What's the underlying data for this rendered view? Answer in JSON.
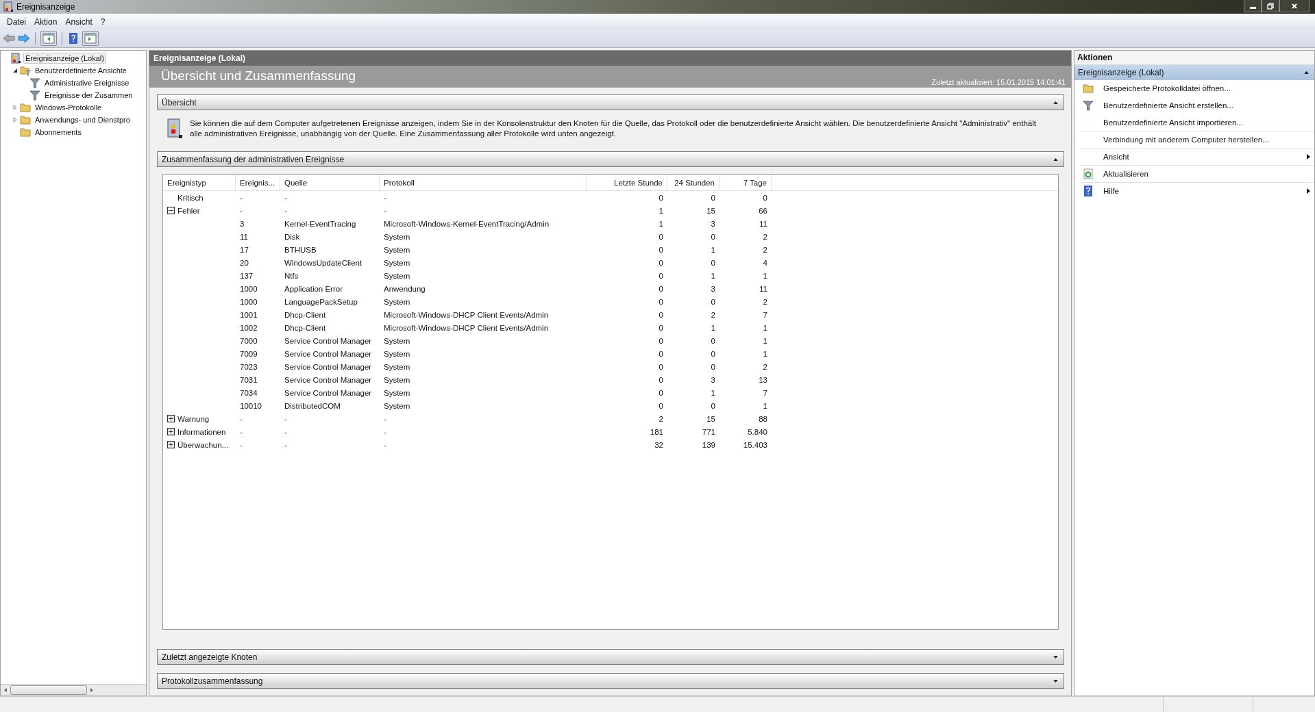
{
  "window": {
    "title": "Ereignisanzeige"
  },
  "menu": [
    "Datei",
    "Aktion",
    "Ansicht",
    "?"
  ],
  "tree": [
    {
      "label": "Ereignisanzeige (Lokal)",
      "kind": "viewer",
      "selected": true,
      "children": [
        {
          "label": "Benutzerdefinierte Ansichte",
          "kind": "folder-filter",
          "selected": false,
          "expanded": true,
          "children": [
            {
              "label": "Administrative Ereignisse",
              "kind": "filter",
              "selected": false
            },
            {
              "label": "Ereignisse der Zusammen",
              "kind": "filter",
              "selected": false
            }
          ]
        },
        {
          "label": "Windows-Protokolle",
          "kind": "folder",
          "selected": false,
          "expanded": false
        },
        {
          "label": "Anwendungs- und Dienstpro",
          "kind": "folder",
          "selected": false,
          "expanded": false
        },
        {
          "label": "Abonnements",
          "kind": "folder",
          "selected": false
        }
      ]
    }
  ],
  "main": {
    "header": "Ereignisanzeige (Lokal)",
    "title": "Übersicht und Zusammenfassung",
    "updated": "Zuletzt aktualisiert: 15.01.2015 14:01:41",
    "overview": {
      "title": "Übersicht",
      "expanded": true,
      "text": "Sie können die auf dem Computer aufgetretenen Ereignisse anzeigen, indem Sie in der Konsolenstruktur den Knoten für die Quelle, das Protokoll oder die benutzerdefinierte Ansicht wählen. Die benutzerdefinierte Ansicht \"Administrativ\" enthält alle administrativen Ereignisse, unabhängig von der Quelle. Eine Zusammenfassung aller Protokolle wird unten angezeigt."
    },
    "summary": {
      "title": "Zusammenfassung der administrativen Ereignisse",
      "expanded": true,
      "columns": [
        "Ereignistyp",
        "Ereignis...",
        "Quelle",
        "Protokoll",
        "Letzte Stunde",
        "24 Stunden",
        "7 Tage"
      ],
      "groups": [
        {
          "type": "Kritisch",
          "id": "-",
          "source": "-",
          "log": "-",
          "hour": "0",
          "day": "0",
          "week": "0"
        },
        {
          "type": "Fehler",
          "id": "-",
          "source": "-",
          "log": "-",
          "hour": "1",
          "day": "15",
          "week": "66",
          "expanded": true,
          "rows": [
            {
              "id": "3",
              "source": "Kernel-EventTracing",
              "log": "Microsoft-Windows-Kernel-EventTracing/Admin",
              "hour": "1",
              "day": "3",
              "week": "11"
            },
            {
              "id": "11",
              "source": "Disk",
              "log": "System",
              "hour": "0",
              "day": "0",
              "week": "2"
            },
            {
              "id": "17",
              "source": "BTHUSB",
              "log": "System",
              "hour": "0",
              "day": "1",
              "week": "2"
            },
            {
              "id": "20",
              "source": "WindowsUpdateClient",
              "log": "System",
              "hour": "0",
              "day": "0",
              "week": "4"
            },
            {
              "id": "137",
              "source": "Ntfs",
              "log": "System",
              "hour": "0",
              "day": "1",
              "week": "1"
            },
            {
              "id": "1000",
              "source": "Application Error",
              "log": "Anwendung",
              "hour": "0",
              "day": "3",
              "week": "11"
            },
            {
              "id": "1000",
              "source": "LanguagePackSetup",
              "log": "System",
              "hour": "0",
              "day": "0",
              "week": "2"
            },
            {
              "id": "1001",
              "source": "Dhcp-Client",
              "log": "Microsoft-Windows-DHCP Client Events/Admin",
              "hour": "0",
              "day": "2",
              "week": "7"
            },
            {
              "id": "1002",
              "source": "Dhcp-Client",
              "log": "Microsoft-Windows-DHCP Client Events/Admin",
              "hour": "0",
              "day": "1",
              "week": "1"
            },
            {
              "id": "7000",
              "source": "Service Control Manager",
              "log": "System",
              "hour": "0",
              "day": "0",
              "week": "1"
            },
            {
              "id": "7009",
              "source": "Service Control Manager",
              "log": "System",
              "hour": "0",
              "day": "0",
              "week": "1"
            },
            {
              "id": "7023",
              "source": "Service Control Manager",
              "log": "System",
              "hour": "0",
              "day": "0",
              "week": "2"
            },
            {
              "id": "7031",
              "source": "Service Control Manager",
              "log": "System",
              "hour": "0",
              "day": "3",
              "week": "13"
            },
            {
              "id": "7034",
              "source": "Service Control Manager",
              "log": "System",
              "hour": "0",
              "day": "1",
              "week": "7"
            },
            {
              "id": "10010",
              "source": "DistributedCOM",
              "log": "System",
              "hour": "0",
              "day": "0",
              "week": "1"
            }
          ]
        },
        {
          "type": "Warnung",
          "id": "-",
          "source": "-",
          "log": "-",
          "hour": "2",
          "day": "15",
          "week": "88",
          "expanded": false
        },
        {
          "type": "Informationen",
          "id": "-",
          "source": "-",
          "log": "-",
          "hour": "181",
          "day": "771",
          "week": "5.840",
          "expanded": false
        },
        {
          "type": "Überwachun...",
          "id": "-",
          "source": "-",
          "log": "-",
          "hour": "32",
          "day": "139",
          "week": "15.403",
          "expanded": false
        }
      ]
    },
    "sections": [
      {
        "title": "Zuletzt angezeigte Knoten",
        "expanded": false
      },
      {
        "title": "Protokollzusammenfassung",
        "expanded": false
      }
    ]
  },
  "actions": {
    "title": "Aktionen",
    "group": "Ereignisanzeige (Lokal)",
    "expanded": true,
    "items": [
      {
        "label": "Gespeicherte Protokolldatei öffnen...",
        "kind": "folder",
        "submenu": false,
        "divider_after": false
      },
      {
        "label": "Benutzerdefinierte Ansicht erstellen...",
        "kind": "filter",
        "submenu": false,
        "divider_after": false
      },
      {
        "label": "Benutzerdefinierte Ansicht importieren...",
        "kind": "plain",
        "submenu": false,
        "divider_after": true
      },
      {
        "label": "Verbindung mit anderem Computer herstellen...",
        "kind": "plain",
        "submenu": false,
        "divider_after": true
      },
      {
        "label": "Ansicht",
        "kind": "plain",
        "submenu": true,
        "divider_after": true
      },
      {
        "label": "Aktualisieren",
        "kind": "refresh",
        "submenu": false,
        "divider_after": true
      },
      {
        "label": "Hilfe",
        "kind": "help",
        "submenu": true,
        "divider_after": false
      }
    ]
  }
}
